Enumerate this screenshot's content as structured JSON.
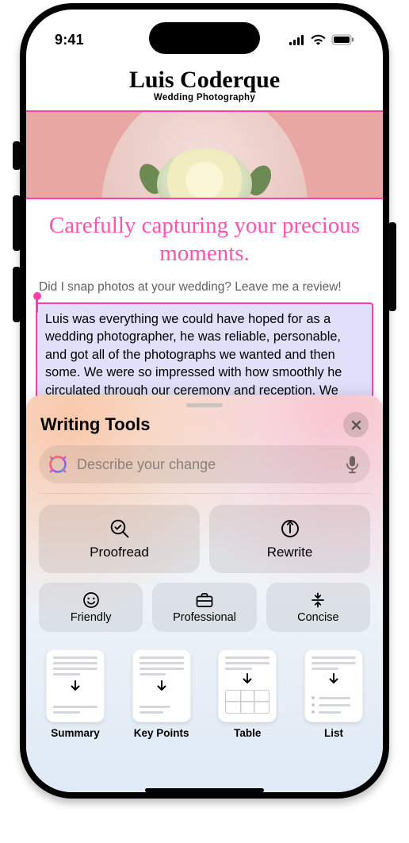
{
  "status": {
    "time": "9:41"
  },
  "brand": {
    "name": "Luis Coderque",
    "sub": "Wedding Photography"
  },
  "page": {
    "headline": "Carefully capturing your precious moments.",
    "prompt": "Did I snap photos at your wedding? Leave me a review!",
    "selected_text": "Luis was everything we could have hoped for as a wedding photographer, he was reliable, personable, and got all of the photographs we wanted and then some. We were so impressed with how smoothly he circulated through our ceremony and reception. We barely realized he was there except when he was very"
  },
  "panel": {
    "title": "Writing Tools",
    "placeholder": "Describe your change",
    "proofread": "Proofread",
    "rewrite": "Rewrite",
    "friendly": "Friendly",
    "professional": "Professional",
    "concise": "Concise",
    "summary": "Summary",
    "keypoints": "Key Points",
    "table": "Table",
    "list": "List"
  }
}
